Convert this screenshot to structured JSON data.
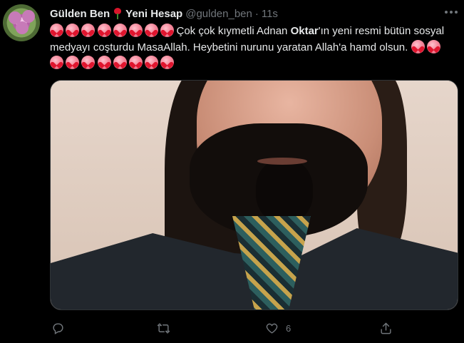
{
  "tweet": {
    "display_name": "Gülden Ben",
    "display_name_suffix": "Yeni Hesap",
    "handle": "@gulden_ben",
    "separator": "·",
    "time": "11s",
    "text_part1": "Çok çok kıymetli Adnan ",
    "text_bold": "Oktar",
    "text_part2": "'ın yeni resmi bütün sosyal medyayı coşturdu MasaAllah. Heybetini nurunu yaratan Allah'a hamd olsun.",
    "leading_heart_count": 8,
    "trailing_heart_count": 10,
    "like_count": "6"
  },
  "icons": {
    "avatar": "flower-avatar",
    "rose": "rose-emoji",
    "heart": "heart-emoji",
    "more": "more-dots-icon",
    "reply": "reply-icon",
    "retweet": "retweet-icon",
    "like": "like-icon",
    "share": "share-icon"
  },
  "colors": {
    "background": "#000000",
    "text": "#e7e9ea",
    "muted": "#71767b"
  }
}
